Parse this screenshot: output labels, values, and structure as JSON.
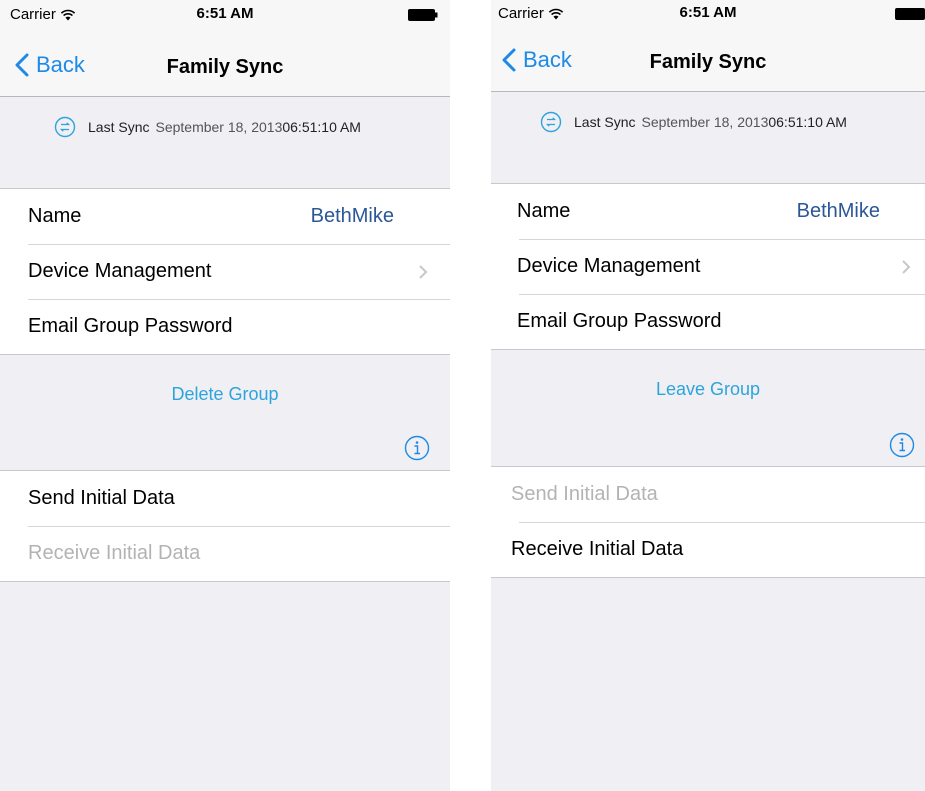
{
  "status_bar": {
    "carrier": "Carrier",
    "time": "6:51 AM"
  },
  "nav": {
    "back_label": "Back",
    "title": "Family Sync"
  },
  "sync": {
    "label": "Last Sync",
    "date": "September 18, 2013",
    "time": "06:51:10 AM"
  },
  "settings": {
    "name_label": "Name",
    "name_value": "BethMike",
    "device_management_label": "Device Management",
    "email_password_label": "Email Group Password"
  },
  "left_screen": {
    "action_label": "Delete Group",
    "send_label": "Send Initial Data",
    "receive_label": "Receive Initial Data",
    "send_enabled": true,
    "receive_enabled": false
  },
  "right_screen": {
    "action_label": "Leave Group",
    "send_label": "Send Initial Data",
    "receive_label": "Receive Initial Data",
    "send_enabled": false,
    "receive_enabled": true
  },
  "colors": {
    "tint": "#1c8ae6",
    "action_text": "#2ea4dc",
    "value_text": "#2b5797",
    "disabled_text": "#b3b3b3",
    "background": "#efeff4"
  },
  "icons": [
    "wifi-icon",
    "battery-icon",
    "back-chevron-icon",
    "sync-icon",
    "chevron-icon",
    "info-icon"
  ]
}
